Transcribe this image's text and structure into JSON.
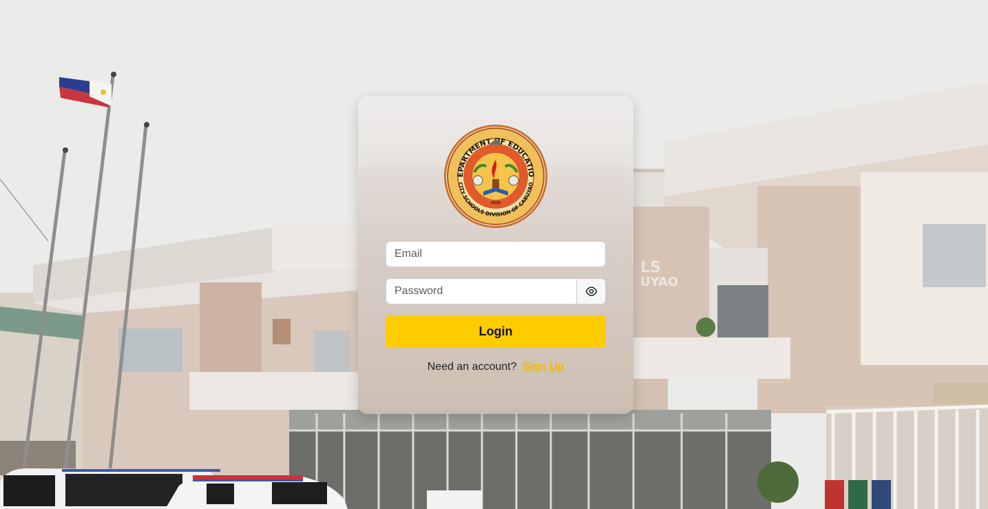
{
  "login": {
    "email_placeholder": "Email",
    "password_placeholder": "Password",
    "login_label": "Login",
    "signup_prompt": "Need an account?",
    "signup_label": "Sign Up"
  },
  "seal": {
    "top_text": "DEPARTMENT OF EDUCATION",
    "bottom_text": "CITY SCHOOLS DIVISION OF CABUYAO",
    "year": "2016"
  },
  "building_sign": "LS ... UYAO",
  "colors": {
    "accent": "#ffcc00",
    "link": "#f5b800"
  },
  "icons": {
    "password_toggle": "eye-icon"
  }
}
